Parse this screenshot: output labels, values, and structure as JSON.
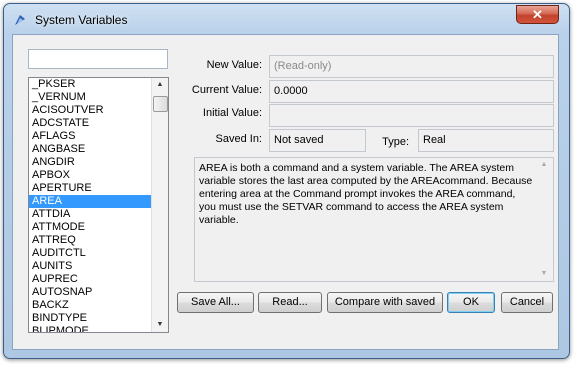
{
  "window": {
    "title": "System Variables",
    "close_glyph": "✕"
  },
  "search": {
    "value": ""
  },
  "variables": [
    "_PKSER",
    "_VERNUM",
    "ACISOUTVER",
    "ADCSTATE",
    "AFLAGS",
    "ANGBASE",
    "ANGDIR",
    "APBOX",
    "APERTURE",
    "AREA",
    "ATTDIA",
    "ATTMODE",
    "ATTREQ",
    "AUDITCTL",
    "AUNITS",
    "AUPREC",
    "AUTOSNAP",
    "BACKZ",
    "BINDTYPE",
    "BLIPMODE"
  ],
  "selected_index": 9,
  "fields": {
    "new_value_label": "New Value:",
    "new_value": "(Read-only)",
    "current_value_label": "Current Value:",
    "current_value": "0.0000",
    "initial_value_label": "Initial Value:",
    "initial_value": "",
    "saved_in_label": "Saved In:",
    "saved_in": "Not saved",
    "type_label": "Type:",
    "type": "Real"
  },
  "description": "AREA is both a command and a system variable. The AREA system variable stores the last area computed by the AREAcommand. Because entering area at the Command prompt invokes the AREA command, you must use the SETVAR command to access the AREA system variable.",
  "buttons": {
    "save_all": "Save All...",
    "read": "Read...",
    "compare": "Compare with saved",
    "ok": "OK",
    "cancel": "Cancel"
  },
  "icons": {
    "app": "app-logo-icon",
    "close": "close-icon",
    "scroll_up": "scroll-up-arrow-icon",
    "scroll_down": "scroll-down-arrow-icon"
  },
  "colors": {
    "selection": "#3399ff",
    "title_frame": "#b9d1ea",
    "close": "#c2432b"
  }
}
